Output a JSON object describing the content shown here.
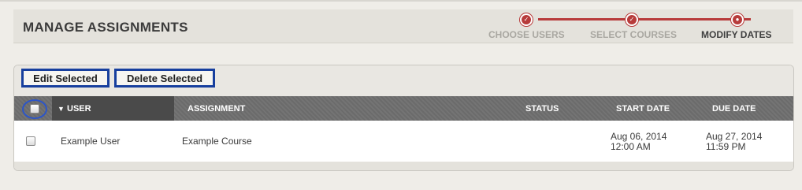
{
  "page": {
    "title": "MANAGE ASSIGNMENTS"
  },
  "steps": [
    {
      "label": "CHOOSE USERS",
      "state": "complete"
    },
    {
      "label": "SELECT COURSES",
      "state": "complete"
    },
    {
      "label": "MODIFY DATES",
      "state": "current"
    }
  ],
  "toolbar": {
    "edit_label": "Edit Selected",
    "delete_label": "Delete Selected"
  },
  "table": {
    "columns": [
      "USER",
      "ASSIGNMENT",
      "STATUS",
      "START DATE",
      "DUE DATE"
    ],
    "sort_indicator": "▼",
    "rows": [
      {
        "user": "Example User",
        "assignment": "Example Course",
        "status": "",
        "start_date": "Aug 06, 2014",
        "start_time": "12:00 AM",
        "due_date": "Aug 27, 2014",
        "due_time": "11:59 PM"
      }
    ]
  },
  "colors": {
    "accent": "#b73b3b",
    "highlight": "#173f9e",
    "header_bg": "#6b6b6b"
  }
}
